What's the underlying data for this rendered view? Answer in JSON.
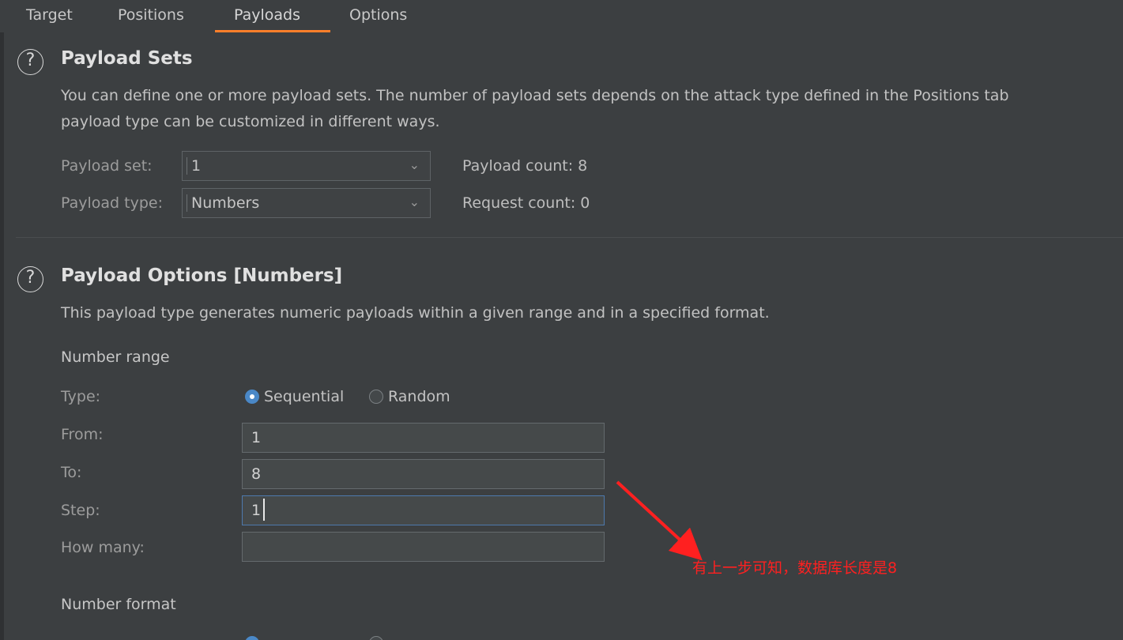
{
  "tabs": [
    {
      "label": "Target"
    },
    {
      "label": "Positions"
    },
    {
      "label": "Payloads"
    },
    {
      "label": "Options"
    }
  ],
  "payload_sets": {
    "title": "Payload Sets",
    "description_line1": "You can define one or more payload sets. The number of payload sets depends on the attack type defined in the Positions tab",
    "description_line2": "payload type can be customized in different ways.",
    "payload_set_label": "Payload set:",
    "payload_set_value": "1",
    "payload_type_label": "Payload type:",
    "payload_type_value": "Numbers",
    "payload_count": "Payload count: 8",
    "request_count": "Request count: 0"
  },
  "payload_options": {
    "title": "Payload Options [Numbers]",
    "description": "This payload type generates numeric payloads within a given range and in a specified format.",
    "number_range_label": "Number range",
    "type_label": "Type:",
    "type_options": [
      "Sequential",
      "Random"
    ],
    "from_label": "From:",
    "from_value": "1",
    "to_label": "To:",
    "to_value": "8",
    "step_label": "Step:",
    "step_value": "1",
    "how_many_label": "How many:",
    "how_many_value": "",
    "number_format_label": "Number format"
  },
  "annotation": {
    "text": "有上一步可知，数据库长度是8"
  },
  "icons": {
    "help": "help-icon",
    "dropdown": "chevron-down-icon"
  },
  "colors": {
    "background": "#3c3f41",
    "accent": "#ff7f2a",
    "selected_radio": "#4a88c7",
    "annotation": "#ff2020"
  }
}
